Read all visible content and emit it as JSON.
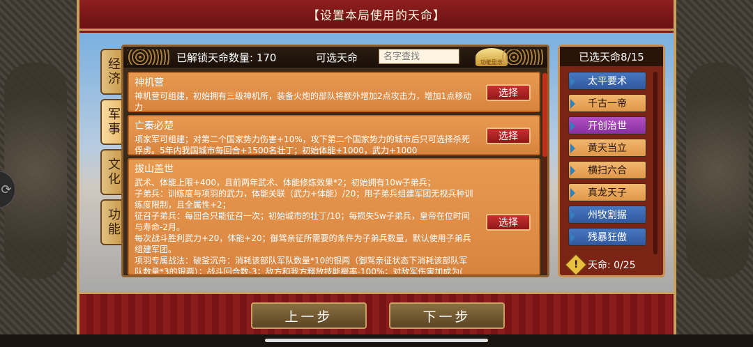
{
  "title": "【设置本局使用的天命】",
  "tabs": [
    {
      "label": "经济",
      "active": false
    },
    {
      "label": "军事",
      "active": true
    },
    {
      "label": "文化",
      "active": false
    },
    {
      "label": "功能",
      "active": false
    }
  ],
  "header": {
    "unlocked_label": "已解锁天命数量: 170",
    "selectable_label": "可选天命",
    "search_placeholder": "名字查找",
    "search_button_label": "功能显示"
  },
  "cards": [
    {
      "title": "神机营",
      "desc": "神机营可组建，初始拥有三级神机所，装备火炮的部队将额外增加2点攻击力，增加1点移动力",
      "button": "选择"
    },
    {
      "title": "亡秦必楚",
      "desc": "项家军可组建；对第二个国家势力伤害+10%，攻下第二个国家势力的城市后只可选择杀死俘虏。5年内我国城市每回合+1500名壮丁；初始体能+1000，武力+1000",
      "button": "选择"
    },
    {
      "title": "拔山盖世",
      "desc": "武术、体能上限+400，且前两年武术、体能修炼效果*2；初始拥有10w子弟兵；\n子弟兵：训练度与项羽的武力，体能关联（武力+体能）/20；用子弟兵组建军团无视兵种训练度限制，且全属性+2；\n征召子弟兵：每回合只能征召一次；初始城市的壮丁/10；每损失5w子弟兵，皇帝在位时间与寿命-2月。\n每次战斗胜利武力+20，体能+20；御驾亲征所需要的条件为子弟兵数量，默认使用子弟兵组建军团。\n项羽专属战法：破釜沉舟：消耗该部队军队数量*10的银两（御驾亲征状态下消耗该部队军队数量*3的银两）；战斗回合数-3；敌方和我方释放技能概率-100%；对敌军伤害加成为(",
      "button": "选择"
    }
  ],
  "selected": {
    "header": "已选天命8/15",
    "items": [
      {
        "label": "太平要术",
        "style": "blue"
      },
      {
        "label": "千古一帝",
        "style": "orange"
      },
      {
        "label": "开创治世",
        "style": "purple"
      },
      {
        "label": "黄天当立",
        "style": "orange"
      },
      {
        "label": "横扫六合",
        "style": "orange"
      },
      {
        "label": "真龙天子",
        "style": "orange"
      },
      {
        "label": "州牧割据",
        "style": "blue"
      },
      {
        "label": "残暴狂傲",
        "style": "blue"
      }
    ],
    "points_label": "天命: 0/25"
  },
  "nav": {
    "prev": "上一步",
    "next": "下一步"
  },
  "colors": {
    "frame_red": "#7a1818",
    "gold": "#c8a060",
    "card_orange": "#e89a50",
    "select_red": "#c83030"
  }
}
